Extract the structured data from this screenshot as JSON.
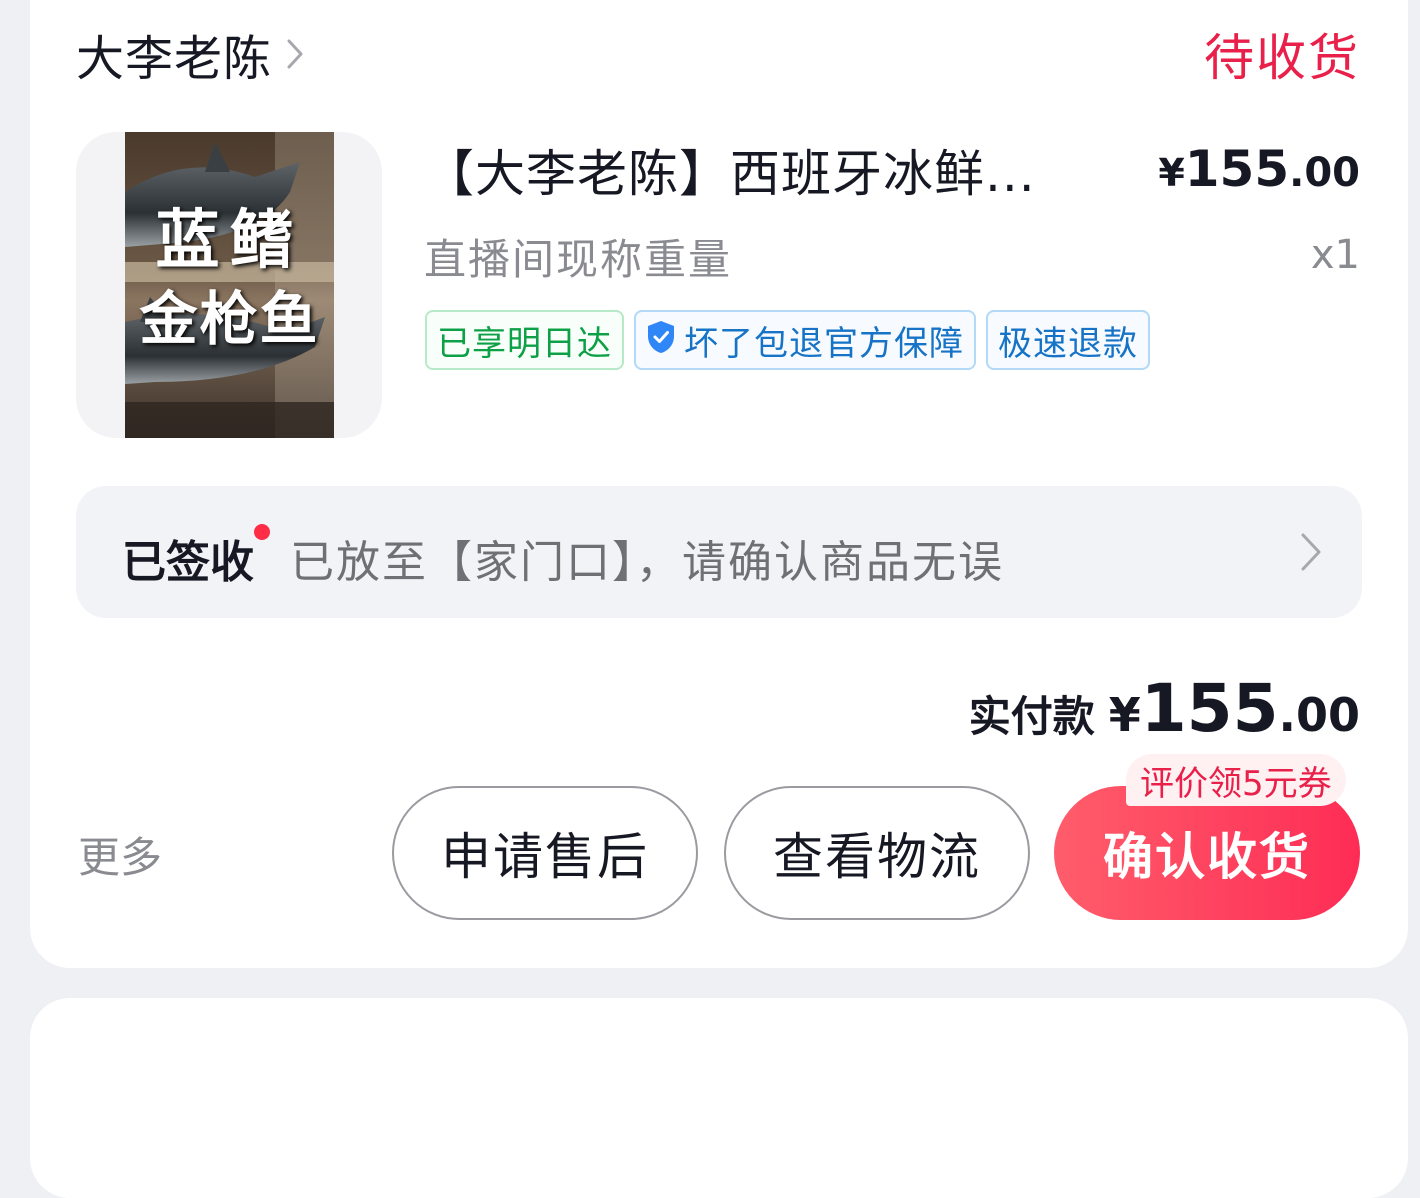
{
  "shop": {
    "name": "大李老陈",
    "status": "待收货"
  },
  "product": {
    "thumbnail_lines": [
      "蓝鳍",
      "金枪鱼"
    ],
    "title": "【大李老陈】西班牙冰鲜...",
    "price_symbol": "¥",
    "price_int": "155",
    "price_dec": ".00",
    "spec": "直播间现称重量",
    "quantity": "x1",
    "tags": [
      {
        "label": "已享明日达",
        "style": "green"
      },
      {
        "label": "坏了包退官方保障",
        "style": "blue",
        "icon": "shield-check-icon"
      },
      {
        "label": "极速退款",
        "style": "blue"
      }
    ]
  },
  "logistics": {
    "state": "已签收",
    "description": "已放至【家门口】，请确认商品无误"
  },
  "payment": {
    "label": "实付款",
    "symbol": "¥",
    "int": "155",
    "dec": ".00"
  },
  "actions": {
    "more": "更多",
    "after_sale": "申请售后",
    "view_logistics": "查看物流",
    "confirm_receipt": "确认收货",
    "coupon_badge": "评价领5元券"
  },
  "colors": {
    "accent_red": "#fe2c55",
    "status_red": "#e8204a",
    "tag_green": "#0ea046",
    "tag_blue": "#1673c6"
  }
}
